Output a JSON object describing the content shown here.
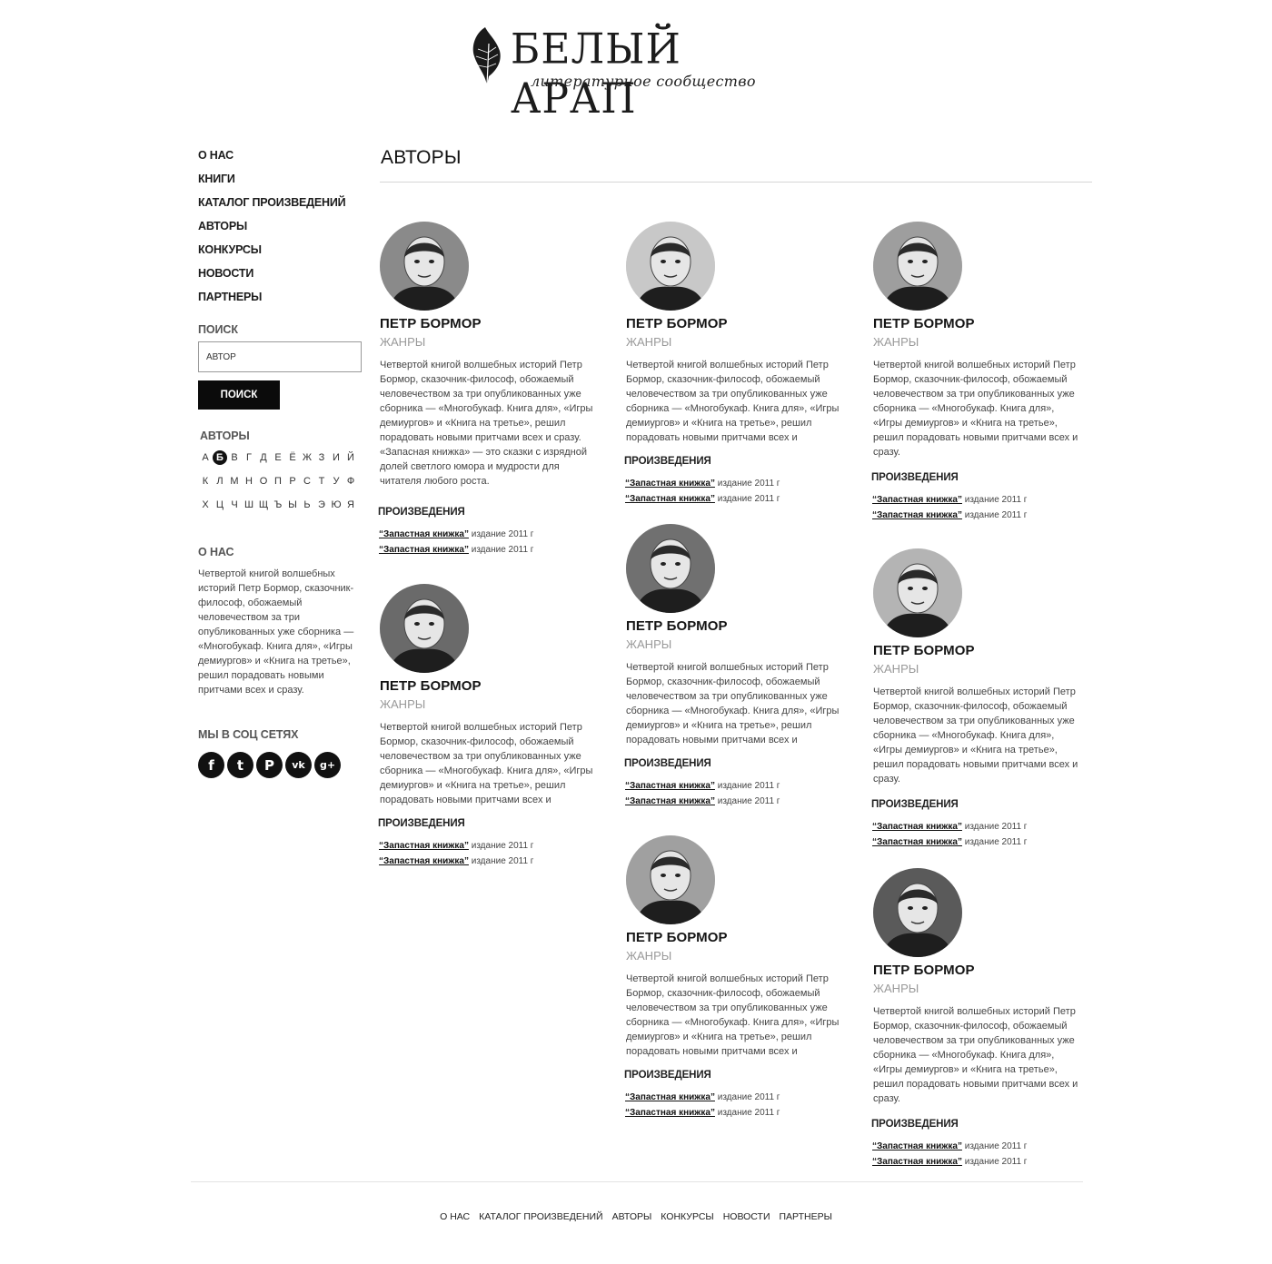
{
  "logo": {
    "title": "БЕЛЫЙ АРАП",
    "subtitle": "литературное сообщество",
    "icon": "feather-icon"
  },
  "nav": [
    "О НАС",
    "КНИГИ",
    "КАТАЛОГ ПРОИЗВЕДЕНИЙ",
    "АВТОРЫ",
    "КОНКУРСЫ",
    "НОВОСТИ",
    "ПАРТНЕРЫ"
  ],
  "search": {
    "heading": "ПОИСК",
    "value": "АВТОР",
    "button": "ПОИСК"
  },
  "authors_filter": {
    "heading": "АВТОРЫ",
    "letters": [
      "А",
      "Б",
      "В",
      "Г",
      "Д",
      "Е",
      "Ё",
      "Ж",
      "З",
      "И",
      "Й",
      "К",
      "Л",
      "М",
      "Н",
      "О",
      "П",
      "Р",
      "С",
      "Т",
      "У",
      "Ф",
      "Х",
      "Ц",
      "Ч",
      "Ш",
      "Щ",
      "Ъ",
      "Ы",
      "Ь",
      "Э",
      "Ю",
      "Я"
    ],
    "active": "Б"
  },
  "about": {
    "heading": "О НАС",
    "text": "Четвертой книгой волшебных историй Петр Бормор, сказочник-философ, обожаемый человечеством за три опубликованных уже сборника — «Многобукаф. Книга для», «Игры демиургов» и «Книга на третье», решил порадовать новыми притчами всех и сразу."
  },
  "social": {
    "heading": "МЫ В СОЦ СЕТЯХ",
    "items": [
      {
        "name": "facebook-icon",
        "glyph": "f"
      },
      {
        "name": "twitter-icon",
        "glyph": "t"
      },
      {
        "name": "pinterest-icon",
        "glyph": "P"
      },
      {
        "name": "vk-icon",
        "glyph": "vk"
      },
      {
        "name": "google-plus-icon",
        "glyph": "g+"
      }
    ]
  },
  "main": {
    "title": "АВТОРЫ",
    "authors": [
      {
        "name": "ПЕТР БОРМОР",
        "genre": "ЖАНРЫ",
        "desc": "Четвертой книгой волшебных историй Петр Бормор, сказочник-философ, обожаемый человечеством за три опубликованных уже сборника — «Многобукаф. Книга для», «Игры демиургов» и «Книга на третье», решил порадовать новыми притчами всех и сразу. «Запасная книжка» — это сказки с изрядной долей светлого юмора и мудрости для читателя любого роста.",
        "works_heading": "ПРОИЗВЕДЕНИЯ",
        "works": [
          {
            "title": "“Запастная книжка”",
            "edition": "издание 2011 г"
          },
          {
            "title": "“Запастная книжка”",
            "edition": "издание 2011 г"
          }
        ]
      },
      {
        "name": "ПЕТР БОРМОР",
        "genre": "ЖАНРЫ",
        "desc": "Четвертой книгой волшебных историй Петр Бормор, сказочник-философ, обожаемый человечеством за три опубликованных уже сборника — «Многобукаф. Книга для», «Игры демиургов» и «Книга на третье», решил порадовать новыми притчами всех и",
        "works_heading": "ПРОИЗВЕДЕНИЯ",
        "works": [
          {
            "title": "“Запастная книжка”",
            "edition": "издание 2011 г"
          },
          {
            "title": "“Запастная книжка”",
            "edition": "издание 2011 г"
          }
        ]
      },
      {
        "name": "ПЕТР БОРМОР",
        "genre": "ЖАНРЫ",
        "desc": "Четвертой книгой волшебных историй Петр Бормор, сказочник-философ, обожаемый человечеством за три опубликованных уже сборника — «Многобукаф. Книга для», «Игры демиургов» и «Книга на третье», решил порадовать новыми притчами всех и сразу.",
        "works_heading": "ПРОИЗВЕДЕНИЯ",
        "works": [
          {
            "title": "“Запастная книжка”",
            "edition": "издание 2011 г"
          },
          {
            "title": "“Запастная книжка”",
            "edition": "издание 2011 г"
          }
        ]
      },
      {
        "name": "ПЕТР БОРМОР",
        "genre": "ЖАНРЫ",
        "desc": "Четвертой книгой волшебных историй Петр Бормор, сказочник-философ, обожаемый человечеством за три опубликованных уже сборника — «Многобукаф. Книга для», «Игры демиургов» и «Книга на третье», решил порадовать новыми притчами всех и",
        "works_heading": "ПРОИЗВЕДЕНИЯ",
        "works": [
          {
            "title": "“Запастная книжка”",
            "edition": "издание 2011 г"
          },
          {
            "title": "“Запастная книжка”",
            "edition": "издание 2011 г"
          }
        ]
      },
      {
        "name": "ПЕТР БОРМОР",
        "genre": "ЖАНРЫ",
        "desc": "Четвертой книгой волшебных историй Петр Бормор, сказочник-философ, обожаемый человечеством за три опубликованных уже сборника — «Многобукаф. Книга для», «Игры демиургов» и «Книга на третье», решил порадовать новыми притчами всех и",
        "works_heading": "ПРОИЗВЕДЕНИЯ",
        "works": [
          {
            "title": "“Запастная книжка”",
            "edition": "издание 2011 г"
          },
          {
            "title": "“Запастная книжка”",
            "edition": "издание 2011 г"
          }
        ]
      },
      {
        "name": "ПЕТР БОРМОР",
        "genre": "ЖАНРЫ",
        "desc": "Четвертой книгой волшебных историй Петр Бормор, сказочник-философ, обожаемый человечеством за три опубликованных уже сборника — «Многобукаф. Книга для», «Игры демиургов» и «Книга на третье», решил порадовать новыми притчами всех и сразу.",
        "works_heading": "ПРОИЗВЕДЕНИЯ",
        "works": [
          {
            "title": "“Запастная книжка”",
            "edition": "издание 2011 г"
          },
          {
            "title": "“Запастная книжка”",
            "edition": "издание 2011 г"
          }
        ]
      },
      {
        "name": "ПЕТР БОРМОР",
        "genre": "ЖАНРЫ",
        "desc": "Четвертой книгой волшебных историй Петр Бормор, сказочник-философ, обожаемый человечеством за три опубликованных уже сборника — «Многобукаф. Книга для», «Игры демиургов» и «Книга на третье», решил порадовать новыми притчами всех и",
        "works_heading": "ПРОИЗВЕДЕНИЯ",
        "works": [
          {
            "title": "“Запастная книжка”",
            "edition": "издание 2011 г"
          },
          {
            "title": "“Запастная книжка”",
            "edition": "издание 2011 г"
          }
        ]
      },
      {
        "name": "ПЕТР БОРМОР",
        "genre": "ЖАНРЫ",
        "desc": "Четвертой книгой волшебных историй Петр Бормор, сказочник-философ, обожаемый человечеством за три опубликованных уже сборника — «Многобукаф. Книга для», «Игры демиургов» и «Книга на третье», решил порадовать новыми притчами всех и сразу.",
        "works_heading": "ПРОИЗВЕДЕНИЯ",
        "works": [
          {
            "title": "“Запастная книжка”",
            "edition": "издание 2011 г"
          },
          {
            "title": "“Запастная книжка”",
            "edition": "издание 2011 г"
          }
        ]
      }
    ]
  },
  "footer": [
    "О НАС",
    "КАТАЛОГ ПРОИЗВЕДЕНИЙ",
    "АВТОРЫ",
    "КОНКУРСЫ",
    "НОВОСТИ",
    "ПАРТНЕРЫ"
  ]
}
